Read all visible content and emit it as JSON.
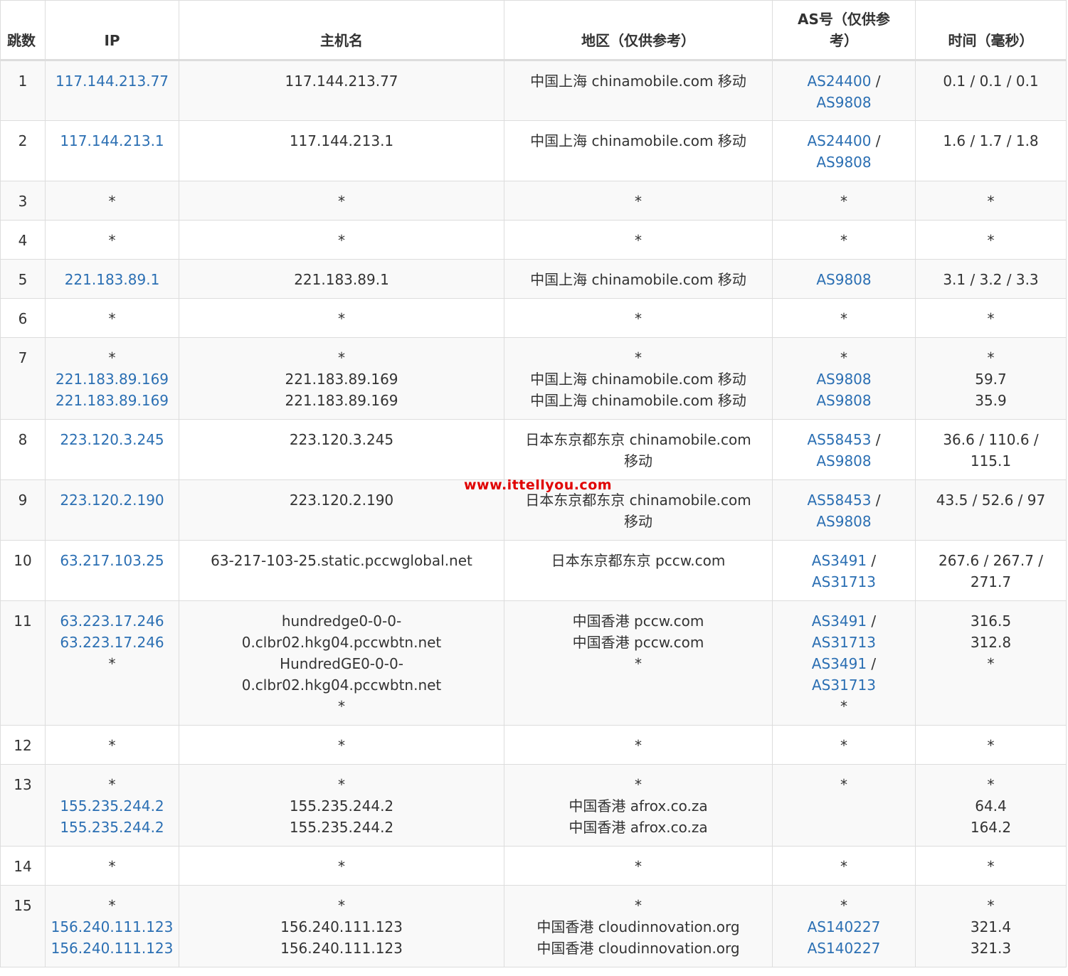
{
  "headers": {
    "hop": "跳数",
    "ip": "IP",
    "host": "主机名",
    "region": "地区（仅供参考）",
    "asn": "AS号（仅供参考）",
    "time": "时间（毫秒）"
  },
  "watermark": "www.ittellyou.com",
  "colors": {
    "link": "#2b6fb3",
    "watermark": "#e00000",
    "row_alt": "#f9f9f9"
  },
  "rows": [
    {
      "hop": "1",
      "ip": [
        "117.144.213.77"
      ],
      "host": [
        "117.144.213.77"
      ],
      "region": [
        "中国上海 chinamobile.com 移动"
      ],
      "asn": [
        [
          "AS24400",
          "AS9808"
        ]
      ],
      "time": [
        "0.1 / 0.1 / 0.1"
      ]
    },
    {
      "hop": "2",
      "ip": [
        "117.144.213.1"
      ],
      "host": [
        "117.144.213.1"
      ],
      "region": [
        "中国上海 chinamobile.com 移动"
      ],
      "asn": [
        [
          "AS24400",
          "AS9808"
        ]
      ],
      "time": [
        "1.6 / 1.7 / 1.8"
      ]
    },
    {
      "hop": "3",
      "ip": [
        "*"
      ],
      "host": [
        "*"
      ],
      "region": [
        "*"
      ],
      "asn": [
        "*"
      ],
      "time": [
        "*"
      ]
    },
    {
      "hop": "4",
      "ip": [
        "*"
      ],
      "host": [
        "*"
      ],
      "region": [
        "*"
      ],
      "asn": [
        "*"
      ],
      "time": [
        "*"
      ]
    },
    {
      "hop": "5",
      "ip": [
        "221.183.89.1"
      ],
      "host": [
        "221.183.89.1"
      ],
      "region": [
        "中国上海 chinamobile.com 移动"
      ],
      "asn": [
        [
          "AS9808"
        ]
      ],
      "time": [
        "3.1 / 3.2 / 3.3"
      ]
    },
    {
      "hop": "6",
      "ip": [
        "*"
      ],
      "host": [
        "*"
      ],
      "region": [
        "*"
      ],
      "asn": [
        "*"
      ],
      "time": [
        "*"
      ]
    },
    {
      "hop": "7",
      "ip": [
        "*",
        "221.183.89.169",
        "221.183.89.169"
      ],
      "host": [
        "*",
        "221.183.89.169",
        "221.183.89.169"
      ],
      "region": [
        "*",
        "中国上海 chinamobile.com 移动",
        "中国上海 chinamobile.com 移动"
      ],
      "asn": [
        "*",
        [
          "AS9808"
        ],
        [
          "AS9808"
        ]
      ],
      "time": [
        "*",
        "59.7",
        "35.9"
      ]
    },
    {
      "hop": "8",
      "ip": [
        "223.120.3.245"
      ],
      "host": [
        "223.120.3.245"
      ],
      "region": [
        "日本东京都东京 chinamobile.com",
        "移动"
      ],
      "asn": [
        [
          "AS58453",
          "AS9808"
        ]
      ],
      "time": [
        "36.6 / 110.6 /",
        "115.1"
      ]
    },
    {
      "hop": "9",
      "ip": [
        "223.120.2.190"
      ],
      "host": [
        "223.120.2.190"
      ],
      "region": [
        "日本东京都东京 chinamobile.com",
        "移动"
      ],
      "asn": [
        [
          "AS58453",
          "AS9808"
        ]
      ],
      "time": [
        "43.5 / 52.6 / 97"
      ]
    },
    {
      "hop": "10",
      "ip": [
        "63.217.103.25"
      ],
      "host": [
        "63-217-103-25.static.pccwglobal.net"
      ],
      "region": [
        "日本东京都东京 pccw.com"
      ],
      "asn": [
        [
          "AS3491",
          "AS31713"
        ]
      ],
      "time": [
        "267.6 / 267.7 /",
        "271.7"
      ]
    },
    {
      "hop": "11",
      "ip": [
        "63.223.17.246",
        "63.223.17.246",
        "*"
      ],
      "host": [
        "hundredge0-0-0-",
        "0.clbr02.hkg04.pccwbtn.net",
        "HundredGE0-0-0-",
        "0.clbr02.hkg04.pccwbtn.net",
        "*"
      ],
      "region": [
        "中国香港 pccw.com",
        "中国香港 pccw.com",
        "*"
      ],
      "asn": [
        [
          "AS3491",
          "AS31713"
        ],
        [
          "AS3491",
          "AS31713"
        ],
        "*"
      ],
      "time": [
        "316.5",
        "312.8",
        "*"
      ]
    },
    {
      "hop": "12",
      "ip": [
        "*"
      ],
      "host": [
        "*"
      ],
      "region": [
        "*"
      ],
      "asn": [
        "*"
      ],
      "time": [
        "*"
      ]
    },
    {
      "hop": "13",
      "ip": [
        "*",
        "155.235.244.2",
        "155.235.244.2"
      ],
      "host": [
        "*",
        "155.235.244.2",
        "155.235.244.2"
      ],
      "region": [
        "*",
        "中国香港 afrox.co.za",
        "中国香港 afrox.co.za"
      ],
      "asn": [
        "*"
      ],
      "time": [
        "*",
        "64.4",
        "164.2"
      ]
    },
    {
      "hop": "14",
      "ip": [
        "*"
      ],
      "host": [
        "*"
      ],
      "region": [
        "*"
      ],
      "asn": [
        "*"
      ],
      "time": [
        "*"
      ]
    },
    {
      "hop": "15",
      "ip": [
        "*",
        "156.240.111.123",
        "156.240.111.123"
      ],
      "host": [
        "*",
        "156.240.111.123",
        "156.240.111.123"
      ],
      "region": [
        "*",
        "中国香港 cloudinnovation.org",
        "中国香港 cloudinnovation.org"
      ],
      "asn": [
        "*",
        [
          "AS140227"
        ],
        [
          "AS140227"
        ]
      ],
      "time": [
        "*",
        "321.4",
        "321.3"
      ]
    }
  ]
}
